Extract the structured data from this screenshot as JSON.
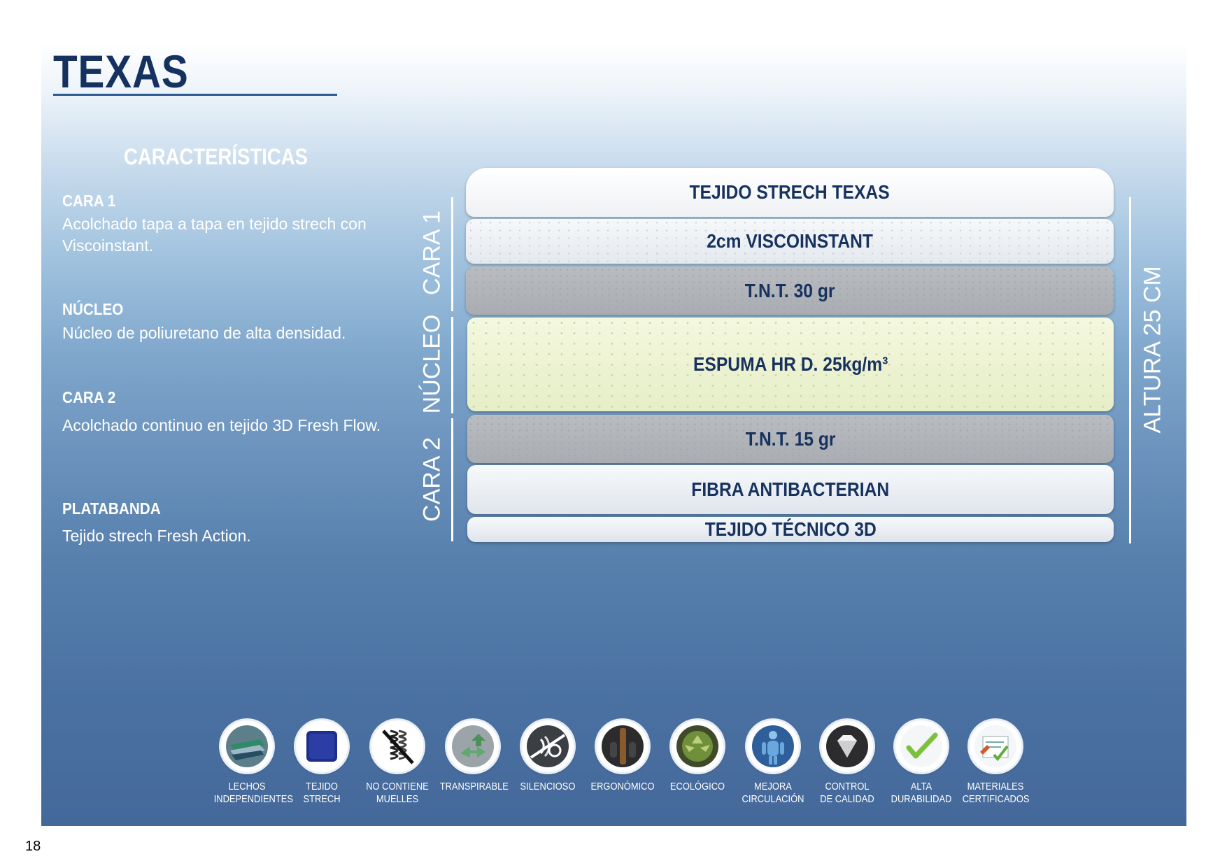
{
  "title": "TEXAS",
  "characteristics_heading": "CARACTERÍSTICAS",
  "sections": [
    {
      "heading": "CARA 1",
      "text": "Acolchado tapa a tapa en tejido strech con Viscoinstant."
    },
    {
      "heading": "NÚCLEO",
      "text": "Núcleo de poliuretano de alta densidad."
    },
    {
      "heading": "CARA 2",
      "text": "Acolchado continuo en tejido 3D Fresh Flow."
    },
    {
      "heading": "PLATABANDA",
      "text": "Tejido strech Fresh Action."
    }
  ],
  "side_labels": {
    "cara1": "CARA 1",
    "nucleo": "NÚCLEO",
    "cara2": "CARA 2",
    "altura": "ALTURA 25 CM"
  },
  "layers": [
    "TEJIDO STRECH TEXAS",
    "2cm VISCOINSTANT",
    "T.N.T. 30 gr",
    "ESPUMA HR D. 25kg/m³",
    "T.N.T. 15 gr",
    "FIBRA ANTIBACTERIAN",
    "TEJIDO TÉCNICO 3D"
  ],
  "features": [
    {
      "icon": "layered-beds-icon",
      "line1": "LECHOS",
      "line2": "INDEPENDIENTES"
    },
    {
      "icon": "fabric-swatch-icon",
      "line1": "TEJIDO",
      "line2": "STRECH"
    },
    {
      "icon": "no-springs-icon",
      "line1": "NO CONTIENE",
      "line2": "MUELLES"
    },
    {
      "icon": "airflow-arrows-icon",
      "line1": "TRANSPIRABLE",
      "line2": ""
    },
    {
      "icon": "silent-icon",
      "line1": "SILENCIOSO",
      "line2": ""
    },
    {
      "icon": "spine-icon",
      "line1": "ERGONÓMICO",
      "line2": ""
    },
    {
      "icon": "recycle-icon",
      "line1": "ECOLÓGICO",
      "line2": ""
    },
    {
      "icon": "body-circulation-icon",
      "line1": "MEJORA",
      "line2": "CIRCULACIÓN"
    },
    {
      "icon": "quality-diamond-icon",
      "line1": "CONTROL",
      "line2": "DE CALIDAD"
    },
    {
      "icon": "checkmark-icon",
      "line1": "ALTA",
      "line2": "DURABILIDAD"
    },
    {
      "icon": "certificate-icon",
      "line1": "MATERIALES",
      "line2": "CERTIFICADOS"
    }
  ],
  "page_number": "18",
  "colors": {
    "title": "#15315f",
    "layer_text": "#17325f",
    "panel_bottom": "#44689a"
  }
}
